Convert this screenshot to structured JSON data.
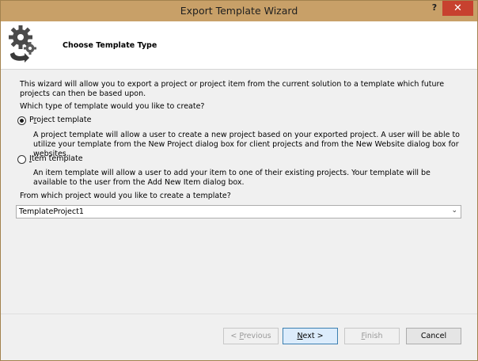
{
  "window": {
    "title": "Export Template Wizard",
    "help_glyph": "?",
    "close_glyph": "✕"
  },
  "header": {
    "title": "Choose Template Type",
    "icon": "gear-arrow-icon"
  },
  "intro_text": "This wizard will allow you to export a project or project item from the current solution to a template which future projects can then be based upon.",
  "question_text": "Which type of template would you like to create?",
  "options": [
    {
      "label_pre": "P",
      "label_mn": "r",
      "label_post": "oject template",
      "selected": true,
      "description": "A project template will allow a user to create a new project based on your exported project. A user will be able to utilize your template from the New Project dialog box for client projects and from the New Website dialog box for websites."
    },
    {
      "label_pre": "",
      "label_mn": "I",
      "label_post": "tem template",
      "selected": false,
      "description": "An item template will allow a user to add your item to one of their existing projects. Your template will be available to the user from the Add New Item dialog box."
    }
  ],
  "project_question": "From which project would you like to create a template?",
  "project_select": {
    "value": "TemplateProject1"
  },
  "buttons": {
    "previous": {
      "pre": "< ",
      "mn": "P",
      "post": "revious",
      "enabled": false
    },
    "next": {
      "pre": "",
      "mn": "N",
      "post": "ext >",
      "enabled": true
    },
    "finish": {
      "pre": "",
      "mn": "F",
      "post": "inish",
      "enabled": false
    },
    "cancel": {
      "label": "Cancel",
      "enabled": true
    }
  },
  "colors": {
    "titlebar": "#c8a068",
    "close_button": "#c7412f",
    "dialog_bg": "#f0f0f0"
  }
}
